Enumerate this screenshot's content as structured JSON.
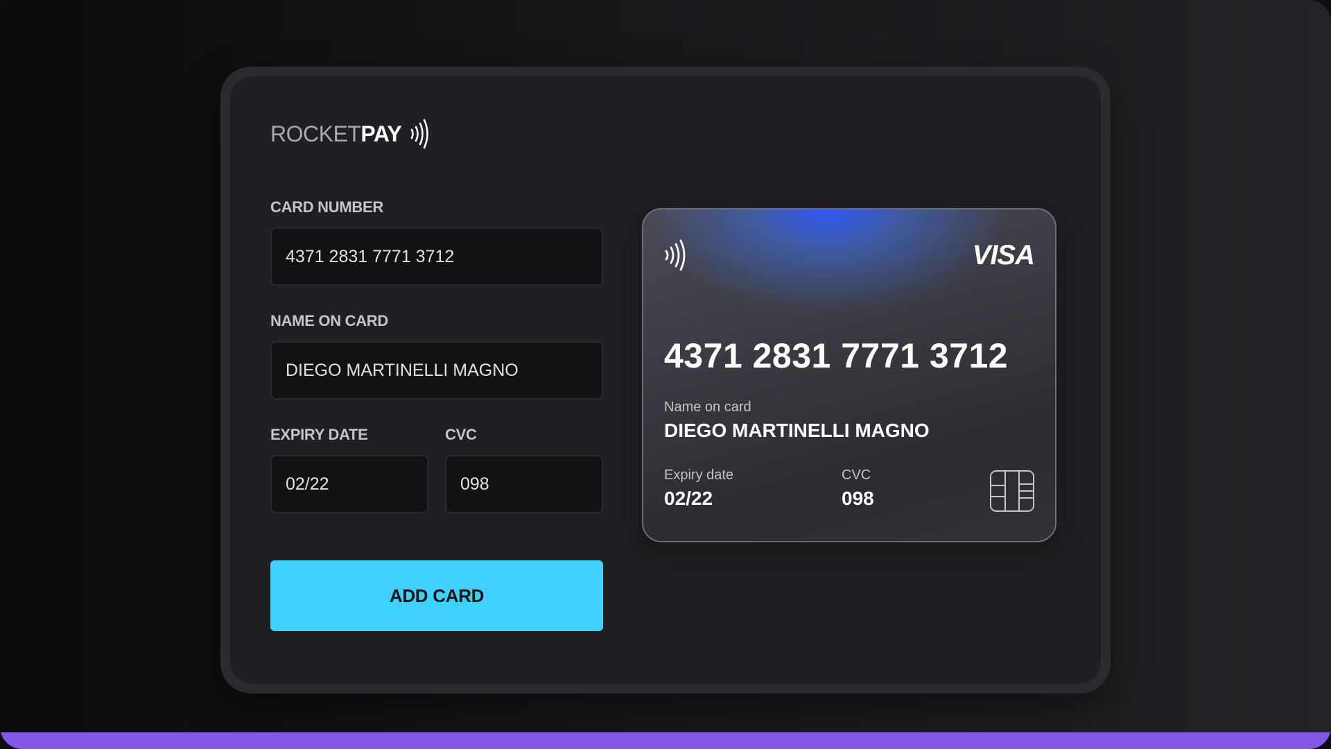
{
  "brand": {
    "logo_light": "ROCKET",
    "logo_bold": "PAY"
  },
  "form": {
    "card_number_label": "CARD NUMBER",
    "card_number_value": "4371 2831 7771 3712",
    "name_label": "NAME ON CARD",
    "name_value": "DIEGO MARTINELLI MAGNO",
    "expiry_label": "EXPIRY DATE",
    "expiry_value": "02/22",
    "cvc_label": "CVC",
    "cvc_value": "098",
    "submit_label": "ADD CARD"
  },
  "card": {
    "network": "VISA",
    "number": "4371 2831 7771 3712",
    "name_label": "Name on card",
    "name": "DIEGO MARTINELLI MAGNO",
    "expiry_label": "Expiry date",
    "expiry": "02/22",
    "cvc_label": "CVC",
    "cvc": "098"
  },
  "icons": {
    "logo_signal": "contactless-icon",
    "card_signal": "contactless-icon",
    "card_chip": "chip-icon"
  },
  "colors": {
    "accent_button": "#40d0fd",
    "bottom_bar": "#8257e5",
    "card_glow": "#2d5aff"
  }
}
